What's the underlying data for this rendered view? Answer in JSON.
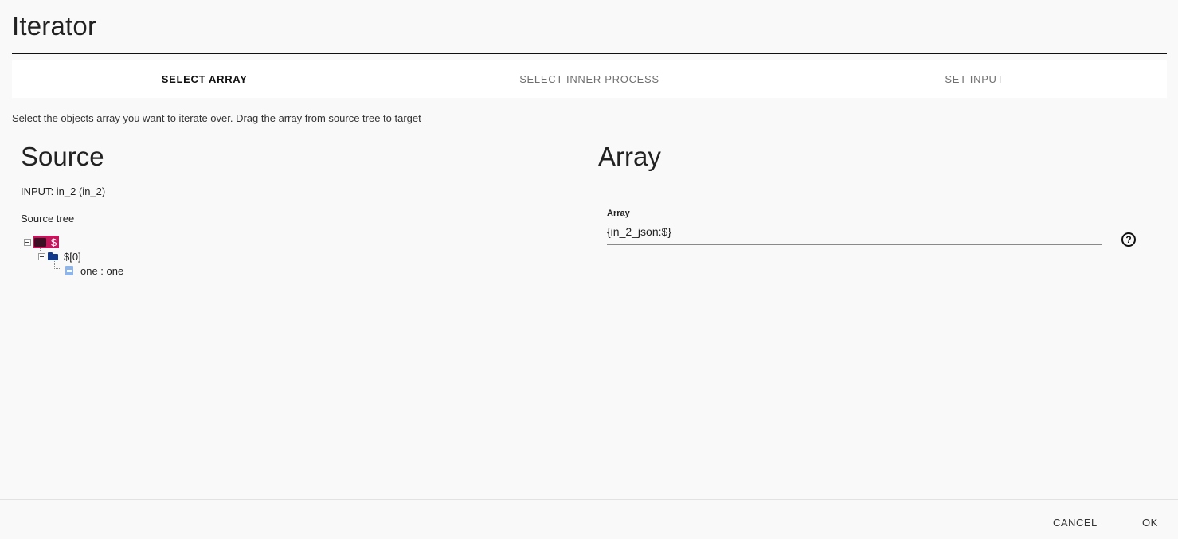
{
  "dialog": {
    "title": "Iterator"
  },
  "stepper": {
    "steps": [
      {
        "label": "SELECT ARRAY",
        "active": true
      },
      {
        "label": "SELECT INNER PROCESS",
        "active": false
      },
      {
        "label": "SET INPUT",
        "active": false
      }
    ]
  },
  "instructions": "Select the objects array you want to iterate over. Drag the array from source tree to target",
  "source": {
    "heading": "Source",
    "input_label": "INPUT",
    "input_value": ": in_2 (in_2)",
    "tree_label": "Source tree",
    "tree": {
      "root": "$",
      "child": "$[0]",
      "leaf": "one : one"
    }
  },
  "array": {
    "heading": "Array",
    "field_label": "Array",
    "field_value": "{in_2_json:$}",
    "help_symbol": "?"
  },
  "footer": {
    "cancel_label": "CANCEL",
    "ok_label": "OK"
  },
  "colors": {
    "accent": "#c2185b",
    "folder": "#123a8c",
    "file": "#8fb4e8"
  }
}
